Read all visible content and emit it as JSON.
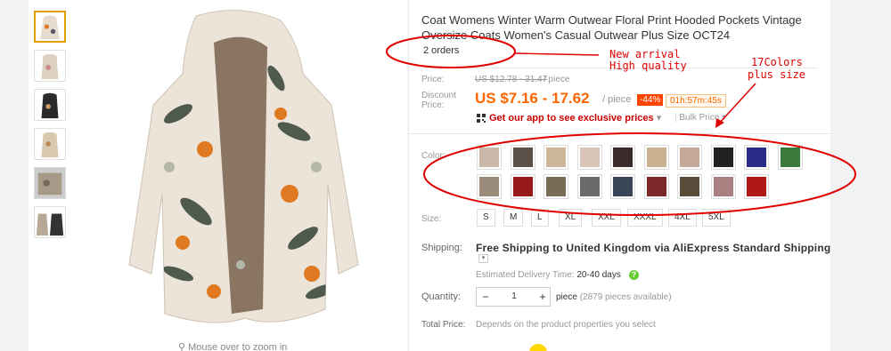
{
  "product": {
    "title": "Coat Womens Winter Warm Outwear Floral Print Hooded Pockets Vintage Oversize Coats Women's Casual Outwear Plus Size OCT24",
    "orders": "2 orders",
    "zoom_hint": "Mouse over to zoom in"
  },
  "pricing": {
    "price_label": "Price:",
    "old_price": "US $12.78 - 31.47",
    "old_unit": "/ piece",
    "discount_label_1": "Discount",
    "discount_label_2": "Price:",
    "price": "US $7.16 - 17.62",
    "price_unit": "/ piece",
    "discount": "-44%",
    "timer": "01h:57m:45s",
    "app_promo": "Get our app to see exclusive prices",
    "bulk_price": "Bulk Price"
  },
  "color": {
    "label": "Color:",
    "swatches": [
      "#c9b8a8",
      "#5a5048",
      "#cdb59a",
      "#d8c5b8",
      "#3b2a2a",
      "#c8b090",
      "#c4a898",
      "#202020",
      "#2a2a88",
      "#3a7a3a",
      "#9a8a7a",
      "#9a1a1a",
      "#7a6a58",
      "#6a6a6a",
      "#3a4658",
      "#7a2828",
      "#5a4a3a",
      "#a88080",
      "#b01818"
    ]
  },
  "size": {
    "label": "Size:",
    "options": [
      "S",
      "M",
      "L",
      "XL",
      "XXL",
      "XXXL",
      "4XL",
      "5XL"
    ]
  },
  "shipping": {
    "label": "Shipping:",
    "text": "Free Shipping to United Kingdom via AliExpress Standard Shipping",
    "est_label": "Estimated Delivery Time:",
    "est_value": "20-40 days"
  },
  "quantity": {
    "label": "Quantity:",
    "value": "1",
    "unit": "piece",
    "available": "(2879 pieces available)"
  },
  "total": {
    "label": "Total Price:",
    "note": "Depends on the product properties you select"
  },
  "annotations": {
    "new_arrival": "New arrival",
    "high_quality": "High quality",
    "colors": "17Colors",
    "plus_size": "plus size"
  },
  "colors": {
    "accent": "#ff6600",
    "annotation": "#e00000"
  }
}
